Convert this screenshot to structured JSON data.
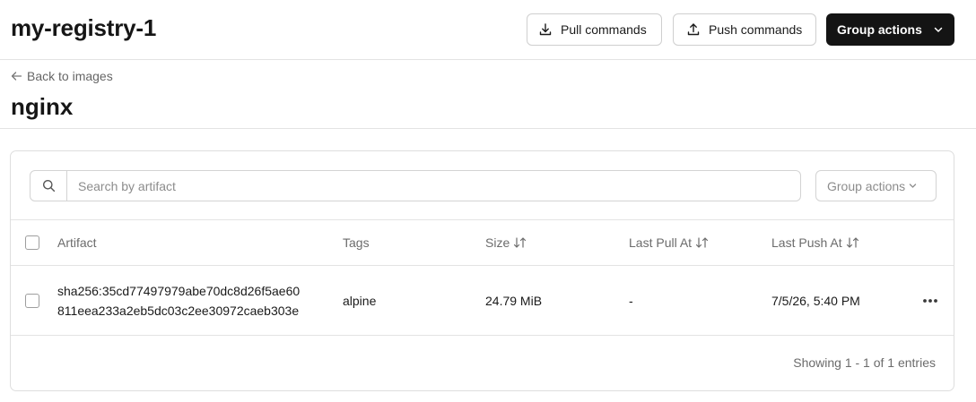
{
  "header": {
    "registry_name": "my-registry-1",
    "pull_commands_label": "Pull commands",
    "push_commands_label": "Push commands",
    "group_actions_label": "Group actions"
  },
  "nav": {
    "back_label": "Back to images"
  },
  "image": {
    "name": "nginx"
  },
  "toolbar": {
    "search_placeholder": "Search by artifact",
    "search_value": "",
    "group_actions_label": "Group actions"
  },
  "table": {
    "columns": {
      "artifact": "Artifact",
      "tags": "Tags",
      "size": "Size",
      "last_pull_at": "Last Pull At",
      "last_push_at": "Last Push At"
    },
    "rows": [
      {
        "digest_line1": "sha256:35cd77497979abe70dc8d26f5ae60",
        "digest_line2": "811eea233a2eb5dc03c2ee30972caeb303e",
        "tags": "alpine",
        "size": "24.79 MiB",
        "last_pull_at": "-",
        "last_push_at": "7/5/26, 5:40 PM"
      }
    ]
  },
  "footer": {
    "entries_text": "Showing 1 - 1 of 1 entries"
  },
  "icons": {
    "pull": "download-icon",
    "push": "upload-icon",
    "group_chevron": "chevron-down-icon",
    "back": "arrow-left-icon",
    "search": "search-icon",
    "sort": "sort-icon",
    "row_actions": "more-horizontal-icon"
  },
  "colors": {
    "primary_dark": "#141414",
    "border": "#dedede",
    "muted_text": "#6b6b6b"
  }
}
